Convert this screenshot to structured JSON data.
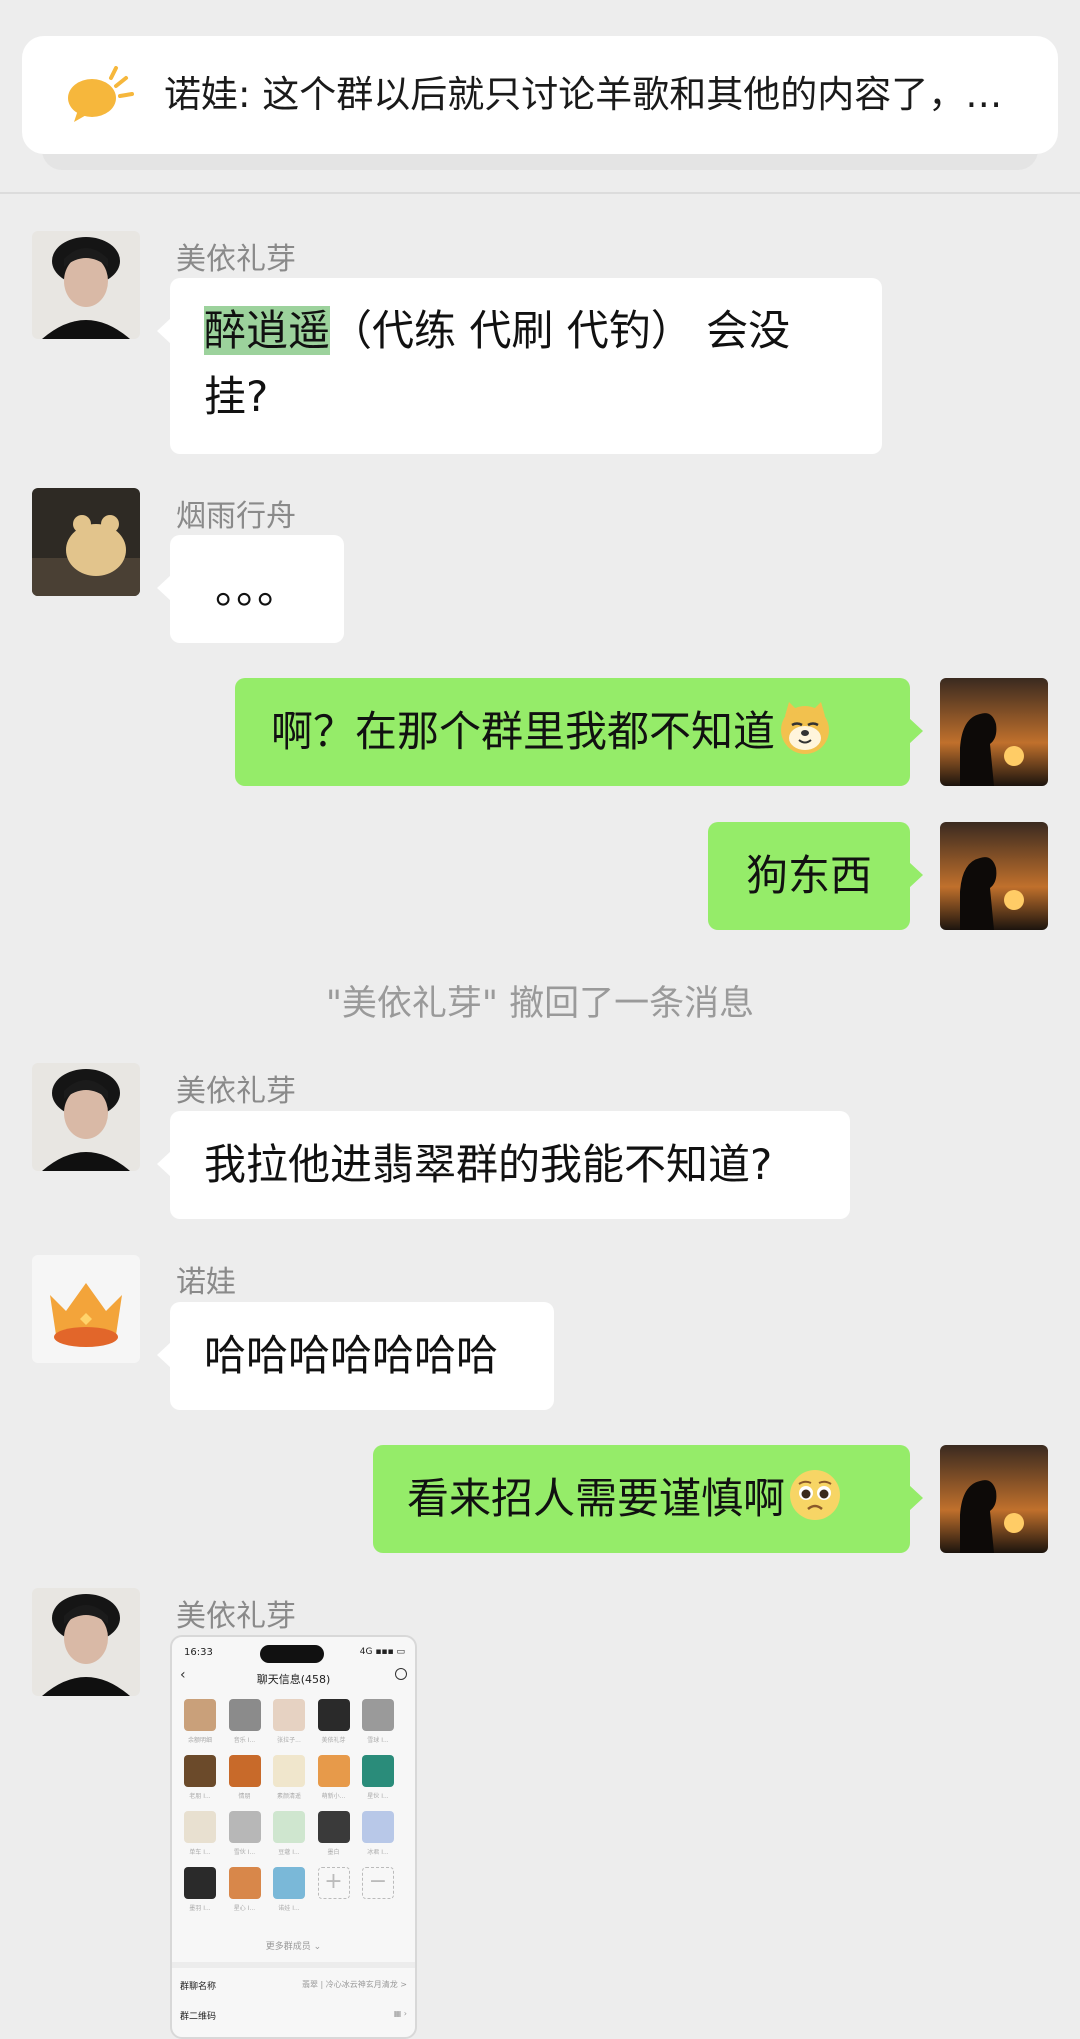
{
  "pinned_notice": {
    "text": "诺娃: 这个群以后就只讨论羊歌和其他的内容了，…",
    "icon": "megaphone-icon",
    "icon_color": "#f6b73c"
  },
  "messages": [
    {
      "sender": "美依礼芽",
      "highlight": "醉逍遥",
      "line1_rest": "（代练 代刷  代钓） 会没",
      "line2": "挂?"
    },
    {
      "sender": "烟雨行舟",
      "text": "。。。"
    },
    {
      "text": "啊？在那个群里我都不知道",
      "emoji": "doge-emoji"
    },
    {
      "text": "狗东西"
    },
    {
      "system": "\"美依礼芽\" 撤回了一条消息"
    },
    {
      "sender": "美依礼芽",
      "text": "我拉他进翡翠群的我能不知道?"
    },
    {
      "sender": "诺娃",
      "text": "哈哈哈哈哈哈哈"
    },
    {
      "text": "看来招人需要谨慎啊",
      "emoji": "pleading-face-emoji"
    },
    {
      "sender": "美依礼芽",
      "image": "group-info-screenshot"
    }
  ],
  "screenshot": {
    "time": "16:33",
    "status": "4G ▪▪▪ ▭",
    "title": "聊天信息(458)",
    "member_names": [
      "余额明细",
      "音乐 I...",
      "张拉子...",
      "美依礼芽",
      "雪球 I...",
      "老朋 I...",
      "情朋",
      "素颜清遥",
      "萌新小...",
      "星伙 I...",
      "单车 I...",
      "雪伙 I...",
      "豆蔻 I...",
      "墨白",
      "冰君 I...",
      "墨羽 I...",
      "星心 I...",
      "诺娃 I..."
    ],
    "more_members": "更多群成员 ⌄",
    "group_name_label": "群聊名称",
    "group_name_value": "翡翠 | 冷心冰云神玄月清龙 >",
    "qr_label": "群二维码"
  },
  "colors": {
    "background": "#ededed",
    "incoming_bubble": "#ffffff",
    "outgoing_bubble": "#95ec69",
    "highlight": "#9cd29c"
  }
}
